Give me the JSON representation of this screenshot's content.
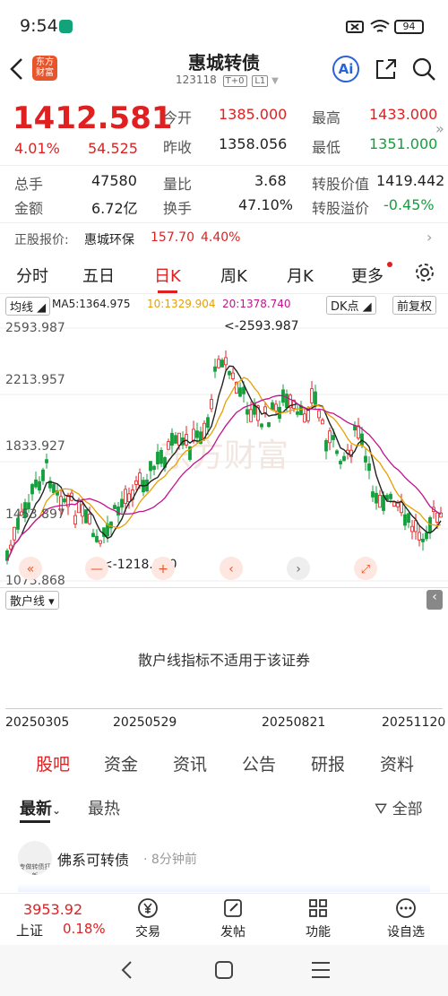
{
  "status": {
    "time": "9:54",
    "battery": "94"
  },
  "header": {
    "title": "惠城转债",
    "code": "123118",
    "badge1": "T+0",
    "badge2": "L1",
    "logo_line1": "东方",
    "logo_line2": "财富",
    "ai": "Ai"
  },
  "quote": {
    "price": "1412.581",
    "pct": "4.01%",
    "change": "54.525",
    "open_label": "今开",
    "open": "1385.000",
    "high_label": "最高",
    "high": "1433.000",
    "prev_label": "昨收",
    "prev": "1358.056",
    "low_label": "最低",
    "low": "1351.000",
    "vol_label": "总手",
    "vol": "47580",
    "ratio_label": "量比",
    "ratio": "3.68",
    "conv_label": "转股价值",
    "conv": "1419.442",
    "amt_label": "金额",
    "amt": "6.72亿",
    "turn_label": "换手",
    "turn": "47.10%",
    "prem_label": "转股溢价",
    "prem": "-0.45%"
  },
  "underlying": {
    "label": "正股报价:",
    "name": "惠城环保",
    "price": "157.70",
    "pct": "4.40%"
  },
  "tabs": [
    "分时",
    "五日",
    "日K",
    "周K",
    "月K",
    "更多"
  ],
  "chart": {
    "ma_label": "均线",
    "ma5": "MA5:1364.975",
    "ma10": "10:1329.904",
    "ma20": "20:1378.740",
    "dk": "DK点",
    "fq": "前复权",
    "y_labels": [
      "2593.987",
      "2213.957",
      "1833.927",
      "1453.897",
      "1073.868"
    ],
    "max_note": "<-2593.987",
    "min_note": "<-1218.000",
    "sub_label": "散户线",
    "sub_msg": "散户线指标不适用于该证券",
    "dates": [
      "20250305",
      "20250529",
      "20250821",
      "20251120"
    ],
    "watermark": "东方财富"
  },
  "chart_data": {
    "type": "candlestick",
    "y_range": [
      1073.868,
      2593.987
    ],
    "x_range": [
      "20250305",
      "20251120"
    ],
    "max": 2593.987,
    "min": 1218.0
  },
  "news_tabs": [
    "股吧",
    "资金",
    "资讯",
    "公告",
    "研报",
    "资料"
  ],
  "sort": {
    "newest": "最新",
    "hottest": "最热",
    "filter": "全部"
  },
  "post": {
    "user": "佛系可转债",
    "time": "8分钟前",
    "avatar_text": "专做转债打新"
  },
  "bottom": {
    "index_value": "3953.92",
    "index_name": "上证",
    "index_pct": "0.18%",
    "trade": "交易",
    "post": "发帖",
    "func": "功能",
    "watch": "设自选"
  },
  "colors": {
    "up": "#e02020",
    "down": "#13a03c",
    "accent": "#e8552a",
    "link": "#2a62d8"
  }
}
